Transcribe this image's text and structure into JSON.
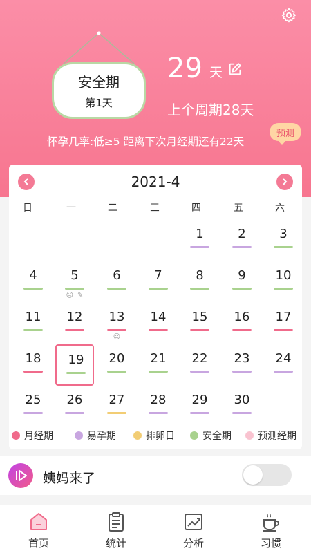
{
  "colors": {
    "accent": "#f47a95",
    "menstrual": "#f06b8b",
    "fertile": "#c8a6e0",
    "ovulation": "#f2cd74",
    "safe": "#a9d28e",
    "predicted": "#f9c3d0"
  },
  "header": {
    "settings_icon": "gear-icon",
    "sign_title": "安全期",
    "sign_day": "第1天",
    "days_count": "29",
    "days_unit": "天",
    "last_cycle": "上个周期28天",
    "info_line": "怀孕几率:低≥5 距离下次月经期还有22天",
    "predict_button": "预测"
  },
  "calendar": {
    "month_label": "2021-4",
    "prev_icon": "chevron-left-icon",
    "next_icon": "chevron-right-icon",
    "weekdays": [
      "日",
      "一",
      "二",
      "三",
      "四",
      "五",
      "六"
    ],
    "selected_day": "19",
    "days": [
      {
        "day": "1",
        "phase": "fertile"
      },
      {
        "day": "2",
        "phase": "fertile"
      },
      {
        "day": "3",
        "phase": "safe"
      },
      {
        "day": "4",
        "phase": "safe"
      },
      {
        "day": "5",
        "phase": "safe",
        "icons": [
          "sad-face-icon",
          "note-icon"
        ]
      },
      {
        "day": "6",
        "phase": "safe"
      },
      {
        "day": "7",
        "phase": "safe"
      },
      {
        "day": "8",
        "phase": "safe"
      },
      {
        "day": "9",
        "phase": "safe"
      },
      {
        "day": "10",
        "phase": "safe"
      },
      {
        "day": "11",
        "phase": "safe"
      },
      {
        "day": "12",
        "phase": "menstrual"
      },
      {
        "day": "13",
        "phase": "menstrual",
        "icons": [
          "smile-face-icon"
        ]
      },
      {
        "day": "14",
        "phase": "menstrual"
      },
      {
        "day": "15",
        "phase": "menstrual"
      },
      {
        "day": "16",
        "phase": "menstrual"
      },
      {
        "day": "17",
        "phase": "menstrual"
      },
      {
        "day": "18",
        "phase": "menstrual"
      },
      {
        "day": "19",
        "phase": "safe"
      },
      {
        "day": "20",
        "phase": "safe"
      },
      {
        "day": "21",
        "phase": "safe"
      },
      {
        "day": "22",
        "phase": "fertile"
      },
      {
        "day": "23",
        "phase": "fertile"
      },
      {
        "day": "24",
        "phase": "fertile"
      },
      {
        "day": "25",
        "phase": "fertile"
      },
      {
        "day": "26",
        "phase": "fertile"
      },
      {
        "day": "27",
        "phase": "ovulation"
      },
      {
        "day": "28",
        "phase": "fertile"
      },
      {
        "day": "29",
        "phase": "fertile"
      },
      {
        "day": "30",
        "phase": "fertile"
      }
    ],
    "legend": [
      {
        "label": "月经期",
        "phase": "menstrual"
      },
      {
        "label": "易孕期",
        "phase": "fertile"
      },
      {
        "label": "排卵日",
        "phase": "ovulation"
      },
      {
        "label": "安全期",
        "phase": "safe"
      },
      {
        "label": "预测经期",
        "phase": "predicted"
      }
    ]
  },
  "period_row": {
    "icon": "play-icon",
    "label": "姨妈来了",
    "toggle_on": false
  },
  "bottom_nav": [
    {
      "label": "首页",
      "icon": "home-icon",
      "active": true
    },
    {
      "label": "统计",
      "icon": "clipboard-icon",
      "active": false
    },
    {
      "label": "分析",
      "icon": "chart-icon",
      "active": false
    },
    {
      "label": "习惯",
      "icon": "coffee-cup-icon",
      "active": false
    }
  ]
}
